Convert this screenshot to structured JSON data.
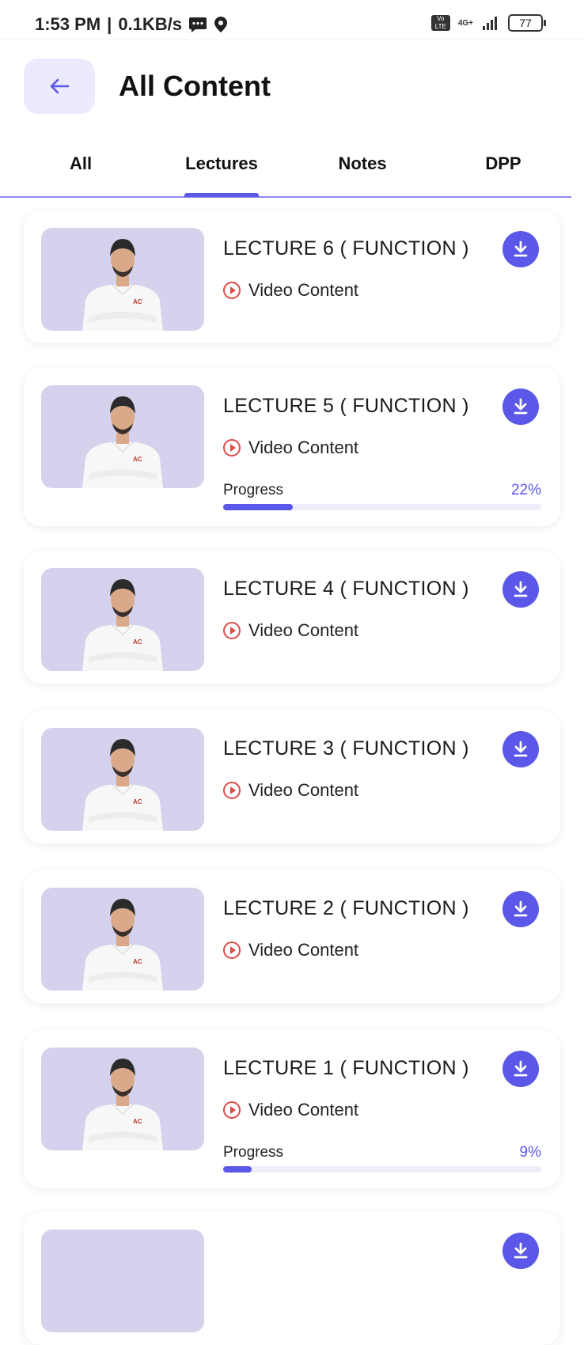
{
  "status_bar": {
    "time": "1:53 PM",
    "speed": "0.1KB/s",
    "volte": "Vo LTE",
    "network": "4G+",
    "battery": "77"
  },
  "header": {
    "title": "All Content",
    "back_icon": "arrow-left-icon"
  },
  "tabs": [
    {
      "label": "All",
      "active": false
    },
    {
      "label": "Lectures",
      "active": true
    },
    {
      "label": "Notes",
      "active": false
    },
    {
      "label": "DPP",
      "active": false
    }
  ],
  "colors": {
    "accent": "#5B57E8",
    "accent_light": "#ECEBFD",
    "video_icon": "#E04A4A",
    "thumb_bg": "#D4D2EC"
  },
  "lectures": [
    {
      "title": "LECTURE 6 ( FUNCTION )",
      "type": "Video Content"
    },
    {
      "title": "LECTURE 5 ( FUNCTION )",
      "type": "Video Content",
      "progress_label": "Progress",
      "progress": "22%"
    },
    {
      "title": "LECTURE 4 ( FUNCTION )",
      "type": "Video Content"
    },
    {
      "title": "LECTURE 3 ( FUNCTION )",
      "type": "Video Content"
    },
    {
      "title": "LECTURE 2 ( FUNCTION )",
      "type": "Video Content"
    },
    {
      "title": "LECTURE 1 ( FUNCTION )",
      "type": "Video Content",
      "progress_label": "Progress",
      "progress": "9%"
    }
  ]
}
